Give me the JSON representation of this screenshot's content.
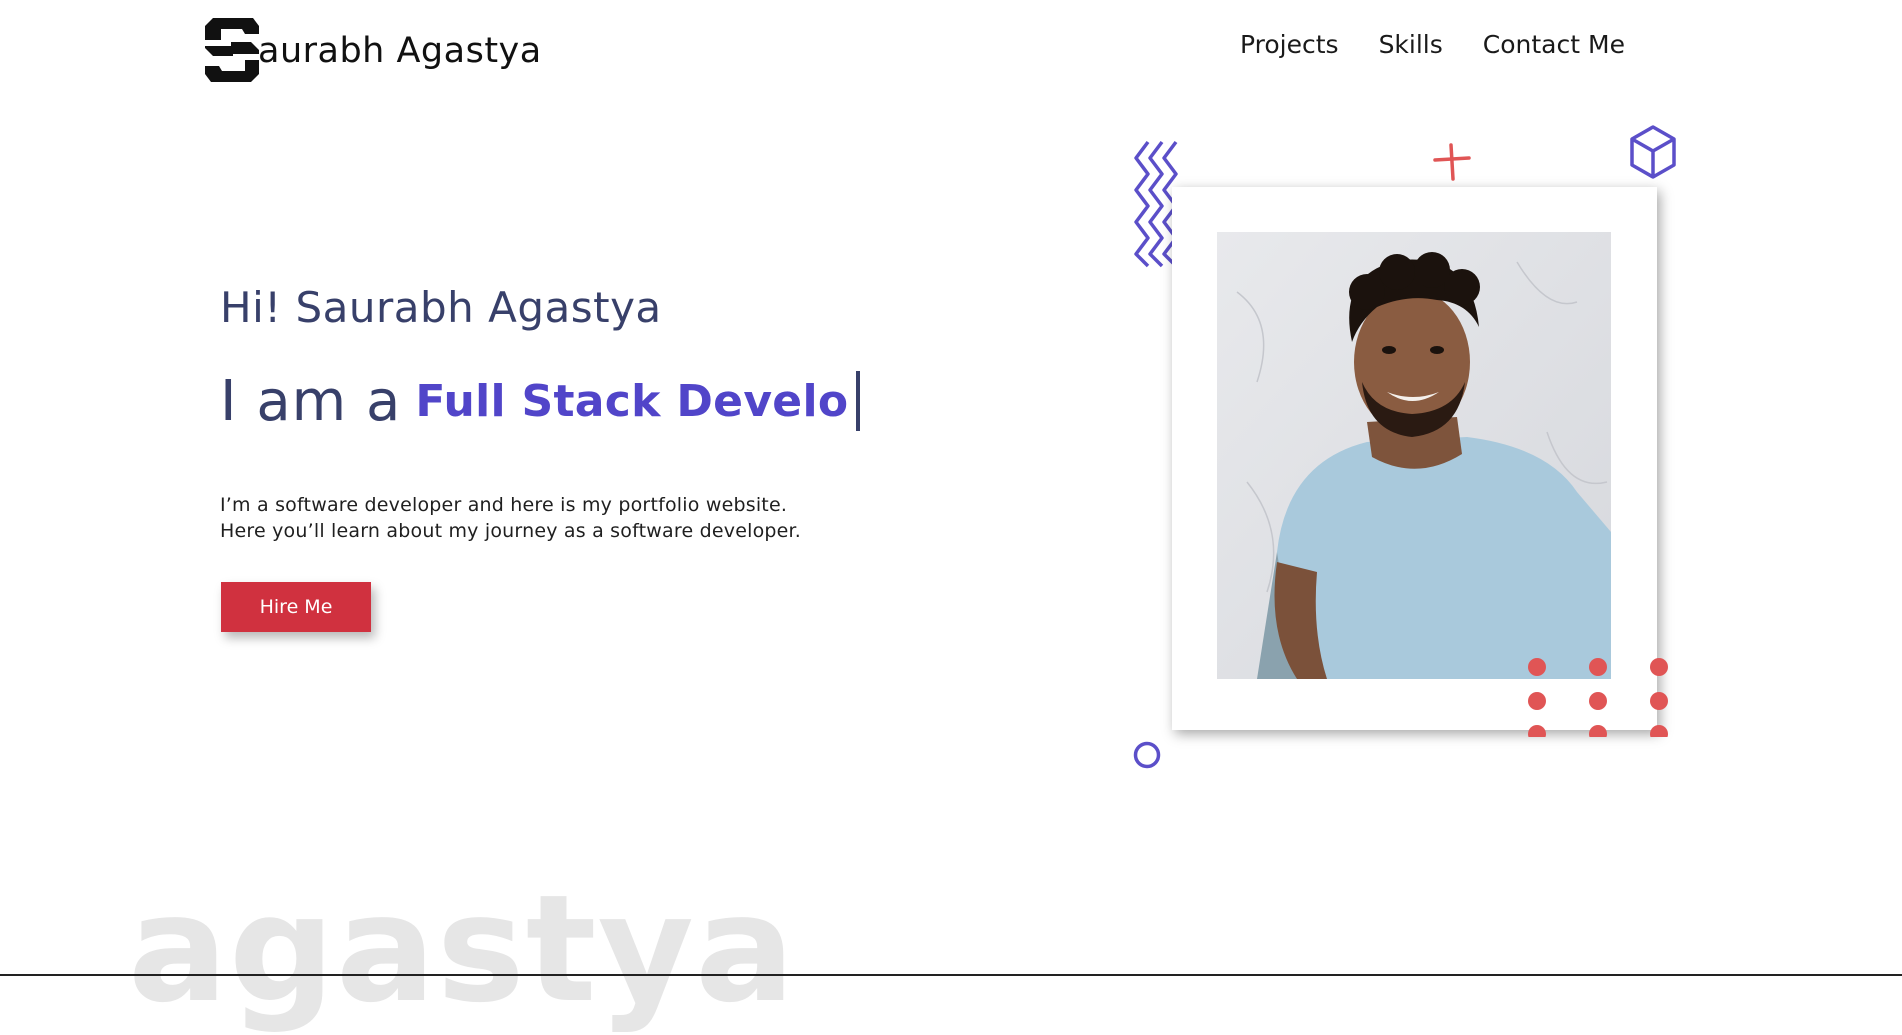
{
  "header": {
    "brand_text": "aurabh Agastya",
    "logo_icon": "s-monogram-icon",
    "nav": [
      {
        "label": "Projects"
      },
      {
        "label": "Skills"
      },
      {
        "label": "Contact Me"
      }
    ]
  },
  "hero": {
    "greeting": "Hi! Saurabh Agastya",
    "role_prefix": "I am a",
    "role_typed": "Full Stack Develo",
    "intro_lines": [
      "I’m a software developer and here is my portfolio website.",
      "Here you’ll learn about my journey as a software developer."
    ],
    "cta_label": "Hire Me"
  },
  "watermark": "agastya",
  "colors": {
    "accent": "#5145c9",
    "heading": "#38406a",
    "cta": "#d0313f",
    "decor_red": "#e05555",
    "decor_blue": "#5b4fc9",
    "watermark": "#e6e6e6"
  },
  "icons": {
    "zigzag": "zigzag-lines-icon",
    "plus": "plus-icon",
    "cube": "cube-icon",
    "ring": "circle-ring-icon",
    "dots": "dot-grid-icon"
  }
}
